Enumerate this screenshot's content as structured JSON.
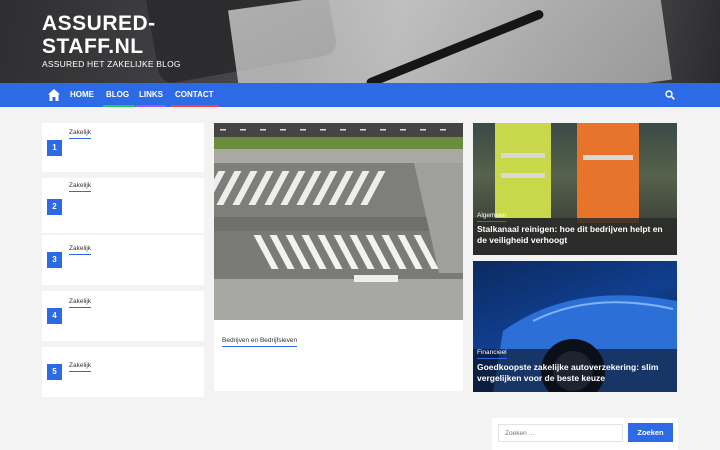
{
  "site": {
    "title": "ASSURED-STAFF.NL",
    "tagline": "ASSURED HET ZAKELIJKE BLOG"
  },
  "nav": {
    "items": [
      {
        "label": "HOME",
        "accent": "#2d6be6"
      },
      {
        "label": "BLOG",
        "accent": "#22c55e"
      },
      {
        "label": "LINKS",
        "accent": "#8b5cf6"
      },
      {
        "label": "CONTACT",
        "accent": "#ef4444"
      }
    ]
  },
  "list": [
    {
      "number": "1",
      "category": "Zakelijk"
    },
    {
      "number": "2",
      "category": "Zakelijk"
    },
    {
      "number": "3",
      "category": "Zakelijk"
    },
    {
      "number": "4",
      "category": "Zakelijk"
    },
    {
      "number": "5",
      "category": "Zakelijk"
    }
  ],
  "main_post": {
    "category": "Bedrijven en Bedrijfsleven"
  },
  "featured": [
    {
      "category": "Algemeen",
      "title": "Stalkanaal reinigen: hoe dit bedrijven helpt en de veiligheid verhoogt"
    },
    {
      "category": "Financieel",
      "title": "Goedkoopste zakelijke autoverzekering: slim vergelijken voor de beste keuze"
    }
  ],
  "search": {
    "placeholder": "Zoeken …",
    "button": "Zoeken"
  },
  "colors": {
    "accent": "#2d6be6"
  }
}
